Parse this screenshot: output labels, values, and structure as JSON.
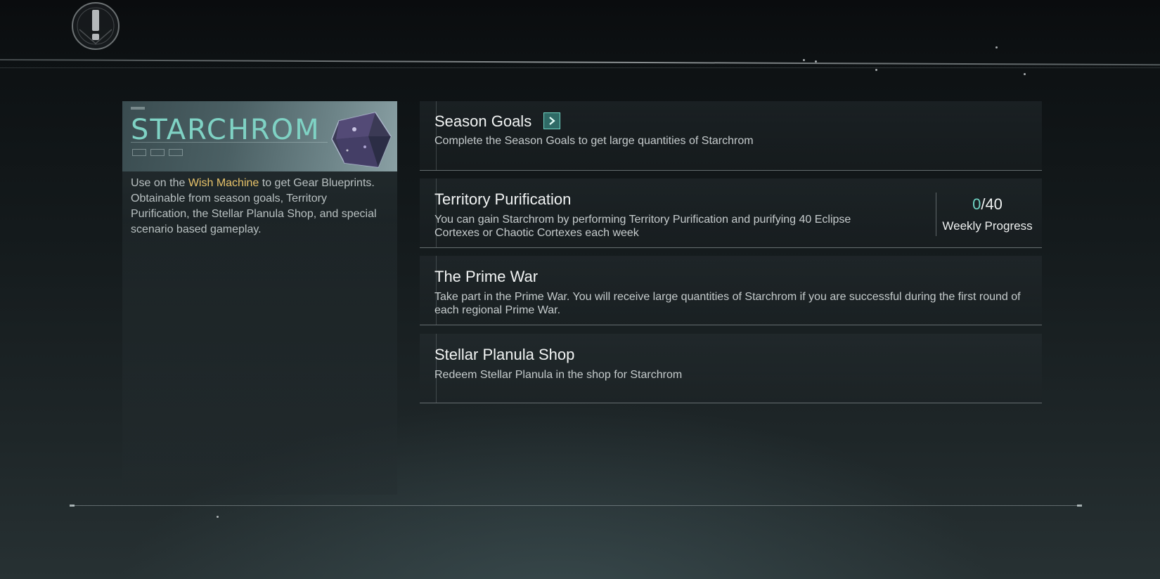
{
  "card": {
    "title": "STARCHROM",
    "description_prefix": "Use on the ",
    "description_highlight": "Wish Machine",
    "description_suffix": " to get Gear Blueprints. Obtainable from season goals, Territory Purification, the Stellar Planula Shop, and special scenario based gameplay.",
    "highlight_color": "#e8c36a",
    "title_color": "#7fd2c4"
  },
  "sources": [
    {
      "title": "Season Goals",
      "description": "Complete the Season Goals to get large quantities of Starchrom",
      "action_icon": "chevron-right-icon"
    },
    {
      "title": "Territory Purification",
      "description": "You can gain Starchrom by performing Territory Purification and purifying 40 Eclipse Cortexes or Chaotic Cortexes each week",
      "progress": {
        "current": "0",
        "total": "/40",
        "label": "Weekly Progress"
      }
    },
    {
      "title": "The Prime War",
      "description": "Take part in the Prime War. You will receive large quantities of Starchrom if you are successful during the first round of each regional Prime War."
    },
    {
      "title": "Stellar Planula Shop",
      "description": "Redeem Stellar Planula in the shop for Starchrom"
    }
  ],
  "accent_color": "#6fd3c3",
  "emblem_icon": "exclamation-emblem-icon"
}
